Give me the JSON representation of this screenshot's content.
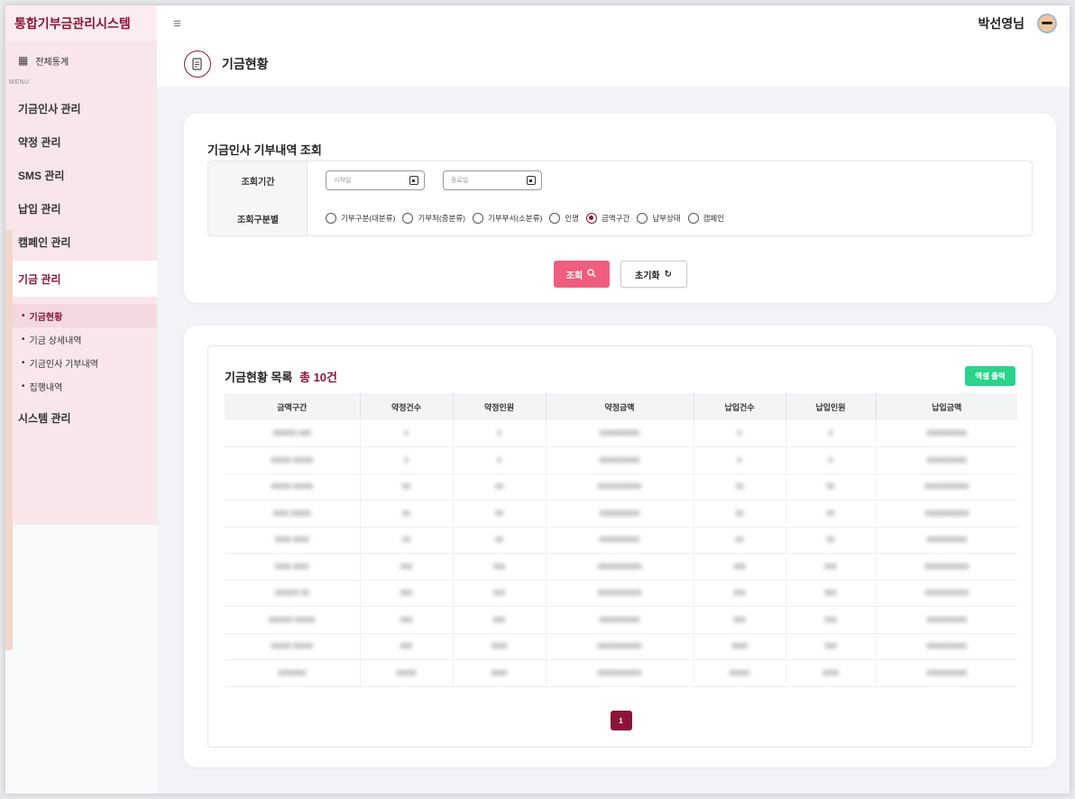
{
  "app": {
    "title": "통합기부금관리시스템",
    "user_name": "박선영님"
  },
  "sidebar": {
    "summary_label": "전체통계",
    "menu_caption": "MENU",
    "items": [
      {
        "label": "기금인사 관리"
      },
      {
        "label": "약정 관리"
      },
      {
        "label": "SMS 관리"
      },
      {
        "label": "납입 관리"
      },
      {
        "label": "캠페인 관리"
      },
      {
        "label": "기금 관리"
      },
      {
        "label": "시스템 관리"
      }
    ],
    "sub_items": [
      {
        "label": "기금현황"
      },
      {
        "label": "기금 상세내역"
      },
      {
        "label": "기금인사 기부내역"
      },
      {
        "label": "집행내역"
      }
    ]
  },
  "page": {
    "title": "기금현황"
  },
  "search": {
    "title": "기금인사 기부내역 조회",
    "period_label": "조회기간",
    "start_placeholder": "시작일",
    "end_placeholder": "종료일",
    "type_label": "조회구분별",
    "options": [
      {
        "label": "기부구분(대분류)"
      },
      {
        "label": "기부처(중분류)"
      },
      {
        "label": "기부부서(소분류)"
      },
      {
        "label": "인명"
      },
      {
        "label": "금액구간"
      },
      {
        "label": "납부상태"
      },
      {
        "label": "캠페인"
      }
    ],
    "selected_option": "금액구간",
    "search_button": "조회",
    "reset_button": "초기화"
  },
  "list": {
    "title": "기금현황 목록",
    "count_text": "총 10건",
    "excel_button": "엑셀 출력",
    "columns": [
      "금액구간",
      "약정건수",
      "약정인원",
      "약정금액",
      "납입건수",
      "납입인원",
      "납입금액"
    ],
    "rows": [
      [
        "000000 000",
        "0",
        "0",
        "0000000000",
        "0",
        "0",
        "0000000000"
      ],
      [
        "00000 00000",
        "0",
        "0",
        "0000000000",
        "0",
        "0",
        "0000000000"
      ],
      [
        "00000 00000",
        "00",
        "00",
        "00000000000",
        "00",
        "00",
        "00000000000"
      ],
      [
        "0000 00000",
        "00",
        "00",
        "0000000000",
        "00",
        "00",
        "00000000000"
      ],
      [
        "0000 0000",
        "00",
        "00",
        "0000000000",
        "00",
        "00",
        "0000000000"
      ],
      [
        "0000 0000",
        "000",
        "000",
        "00000000000",
        "000",
        "000",
        "00000000000"
      ],
      [
        "000000 00",
        "000",
        "000",
        "00000000000",
        "000",
        "000",
        "00000000000"
      ],
      [
        "000000 00000",
        "000",
        "000",
        "0000000000",
        "000",
        "000",
        "0000000000"
      ],
      [
        "00000 00000",
        "000",
        "0000",
        "00000000000",
        "0000",
        "000",
        "0000000000"
      ],
      [
        "0000000",
        "00000",
        "0000",
        "00000000000",
        "00000",
        "0000",
        "0000000000"
      ]
    ],
    "pagination": {
      "current": "1"
    }
  }
}
